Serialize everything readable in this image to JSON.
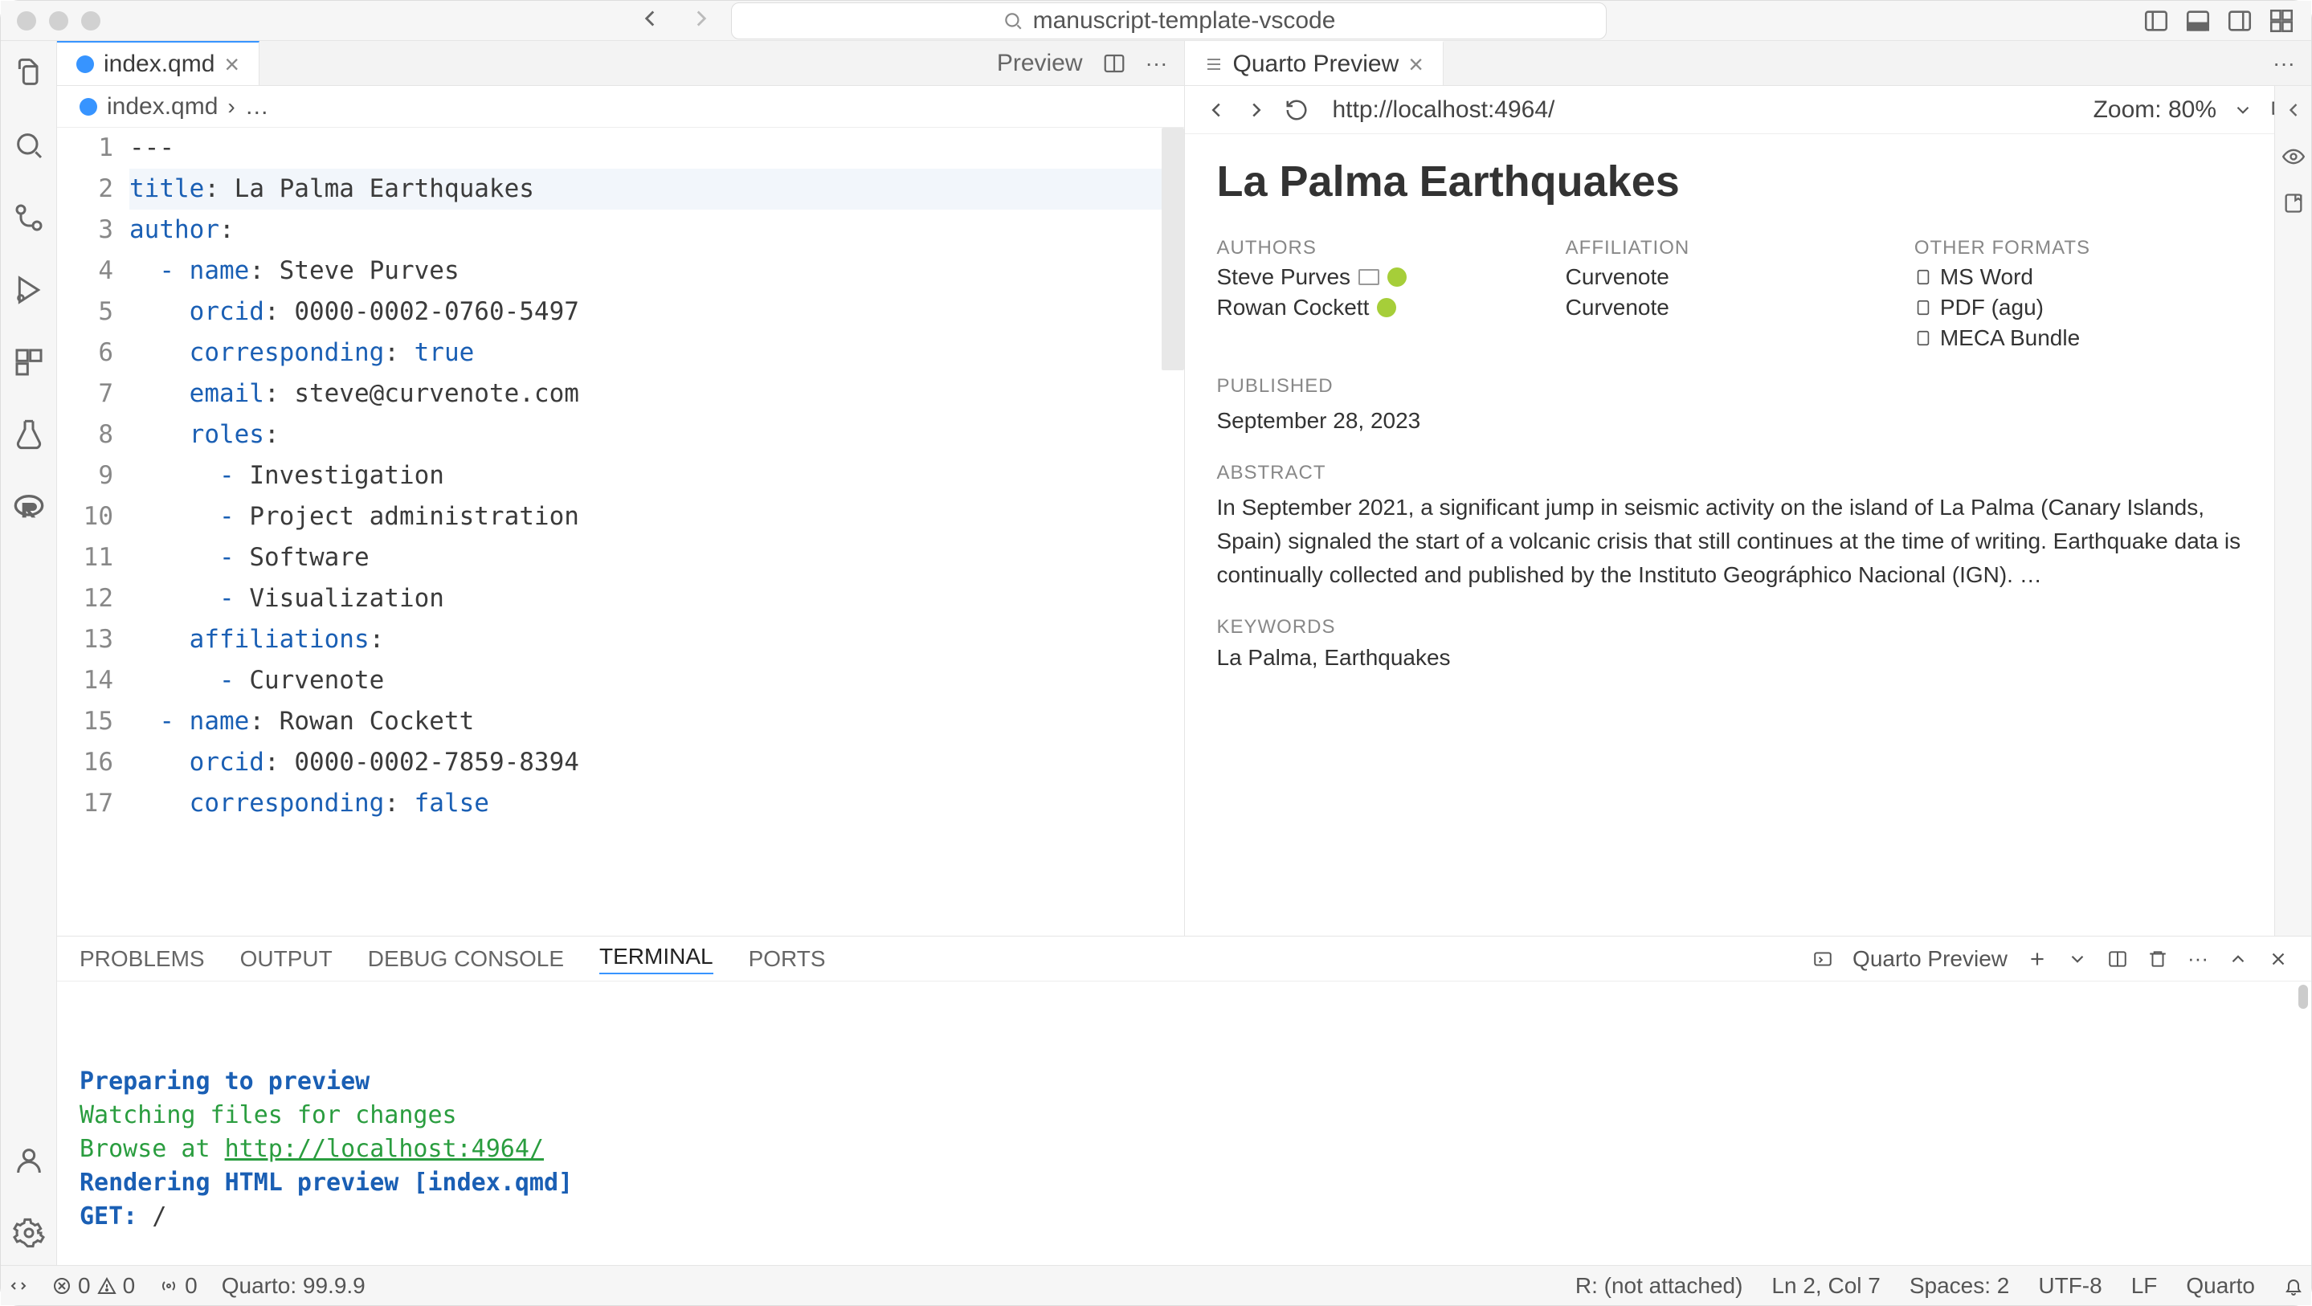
{
  "titlebar": {
    "url": "manuscript-template-vscode"
  },
  "editor": {
    "tab_label": "index.qmd",
    "preview_action": "Preview",
    "breadcrumb": {
      "file": "index.qmd",
      "rest": "…"
    },
    "lines": [
      {
        "n": 1,
        "tokens": [
          {
            "t": "---",
            "c": "str"
          }
        ]
      },
      {
        "n": 2,
        "hl": true,
        "tokens": [
          {
            "t": "title",
            "c": "key"
          },
          {
            "t": ": ",
            "c": "str"
          },
          {
            "t": "La Palma Earthquakes",
            "c": "str"
          }
        ]
      },
      {
        "n": 3,
        "tokens": [
          {
            "t": "author",
            "c": "key"
          },
          {
            "t": ":",
            "c": "str"
          }
        ]
      },
      {
        "n": 4,
        "tokens": [
          {
            "t": "  ",
            "c": "str"
          },
          {
            "t": "-",
            "c": "dash"
          },
          {
            "t": " ",
            "c": "str"
          },
          {
            "t": "name",
            "c": "key"
          },
          {
            "t": ": ",
            "c": "str"
          },
          {
            "t": "Steve Purves",
            "c": "str"
          }
        ]
      },
      {
        "n": 5,
        "tokens": [
          {
            "t": "    ",
            "c": "str"
          },
          {
            "t": "orcid",
            "c": "key"
          },
          {
            "t": ": ",
            "c": "str"
          },
          {
            "t": "0000-0002-0760-5497",
            "c": "str"
          }
        ]
      },
      {
        "n": 6,
        "tokens": [
          {
            "t": "    ",
            "c": "str"
          },
          {
            "t": "corresponding",
            "c": "key"
          },
          {
            "t": ": ",
            "c": "str"
          },
          {
            "t": "true",
            "c": "bool"
          }
        ]
      },
      {
        "n": 7,
        "tokens": [
          {
            "t": "    ",
            "c": "str"
          },
          {
            "t": "email",
            "c": "key"
          },
          {
            "t": ": ",
            "c": "str"
          },
          {
            "t": "steve@curvenote.com",
            "c": "str"
          }
        ]
      },
      {
        "n": 8,
        "tokens": [
          {
            "t": "    ",
            "c": "str"
          },
          {
            "t": "roles",
            "c": "key"
          },
          {
            "t": ":",
            "c": "str"
          }
        ]
      },
      {
        "n": 9,
        "tokens": [
          {
            "t": "      ",
            "c": "str"
          },
          {
            "t": "-",
            "c": "dash"
          },
          {
            "t": " Investigation",
            "c": "str"
          }
        ]
      },
      {
        "n": 10,
        "tokens": [
          {
            "t": "      ",
            "c": "str"
          },
          {
            "t": "-",
            "c": "dash"
          },
          {
            "t": " Project administration",
            "c": "str"
          }
        ]
      },
      {
        "n": 11,
        "tokens": [
          {
            "t": "      ",
            "c": "str"
          },
          {
            "t": "-",
            "c": "dash"
          },
          {
            "t": " Software",
            "c": "str"
          }
        ]
      },
      {
        "n": 12,
        "tokens": [
          {
            "t": "      ",
            "c": "str"
          },
          {
            "t": "-",
            "c": "dash"
          },
          {
            "t": " Visualization",
            "c": "str"
          }
        ]
      },
      {
        "n": 13,
        "tokens": [
          {
            "t": "    ",
            "c": "str"
          },
          {
            "t": "affiliations",
            "c": "key"
          },
          {
            "t": ":",
            "c": "str"
          }
        ]
      },
      {
        "n": 14,
        "tokens": [
          {
            "t": "      ",
            "c": "str"
          },
          {
            "t": "-",
            "c": "dash"
          },
          {
            "t": " Curvenote",
            "c": "str"
          }
        ]
      },
      {
        "n": 15,
        "tokens": [
          {
            "t": "  ",
            "c": "str"
          },
          {
            "t": "-",
            "c": "dash"
          },
          {
            "t": " ",
            "c": "str"
          },
          {
            "t": "name",
            "c": "key"
          },
          {
            "t": ": ",
            "c": "str"
          },
          {
            "t": "Rowan Cockett",
            "c": "str"
          }
        ]
      },
      {
        "n": 16,
        "tokens": [
          {
            "t": "    ",
            "c": "str"
          },
          {
            "t": "orcid",
            "c": "key"
          },
          {
            "t": ": ",
            "c": "str"
          },
          {
            "t": "0000-0002-7859-8394",
            "c": "str"
          }
        ]
      },
      {
        "n": 17,
        "tokens": [
          {
            "t": "    ",
            "c": "str"
          },
          {
            "t": "corresponding",
            "c": "key"
          },
          {
            "t": ": ",
            "c": "str"
          },
          {
            "t": "false",
            "c": "bool"
          }
        ]
      }
    ]
  },
  "preview_tab": {
    "label": "Quarto Preview"
  },
  "preview_nav": {
    "url": "http://localhost:4964/",
    "zoom": "Zoom: 80%"
  },
  "preview": {
    "title": "La Palma Earthquakes",
    "labels": {
      "authors": "AUTHORS",
      "affiliation": "AFFILIATION",
      "other_formats": "OTHER FORMATS",
      "published": "PUBLISHED",
      "abstract": "ABSTRACT",
      "keywords": "KEYWORDS"
    },
    "authors": [
      {
        "name": "Steve Purves",
        "email": true,
        "orcid": true
      },
      {
        "name": "Rowan Cockett",
        "email": false,
        "orcid": true
      }
    ],
    "affiliations": [
      "Curvenote",
      "Curvenote"
    ],
    "other_formats": [
      "MS Word",
      "PDF (agu)",
      "MECA Bundle"
    ],
    "published": "September 28, 2023",
    "abstract": "In September 2021, a significant jump in seismic activity on the island of La Palma (Canary Islands, Spain) signaled the start of a volcanic crisis that still continues at the time of writing. Earthquake data is continually collected and published by the Instituto Geográphico Nacional (IGN). …",
    "keywords": "La Palma, Earthquakes"
  },
  "panel": {
    "tabs": [
      "PROBLEMS",
      "OUTPUT",
      "DEBUG CONSOLE",
      "TERMINAL",
      "PORTS"
    ],
    "active": 3,
    "task_label": "Quarto Preview",
    "terminal": [
      {
        "text": "Preparing to preview",
        "cls": "t-blue"
      },
      {
        "text": "",
        "cls": ""
      },
      {
        "text": "Watching files for changes",
        "cls": "t-green"
      },
      {
        "segments": [
          {
            "text": "Browse at ",
            "cls": "t-green"
          },
          {
            "text": "http://localhost:4964/",
            "cls": "t-link"
          }
        ]
      },
      {
        "text": "Rendering HTML preview [index.qmd]",
        "cls": "t-blue"
      },
      {
        "segments": [
          {
            "text": "GET: ",
            "cls": "t-blue"
          },
          {
            "text": "/",
            "cls": ""
          }
        ]
      }
    ]
  },
  "status": {
    "errors": "0",
    "warnings": "0",
    "ports": "0",
    "quarto": "Quarto: 99.9.9",
    "r": "R: (not attached)",
    "cursor": "Ln 2, Col 7",
    "spaces": "Spaces: 2",
    "encoding": "UTF-8",
    "eol": "LF",
    "lang": "Quarto"
  }
}
